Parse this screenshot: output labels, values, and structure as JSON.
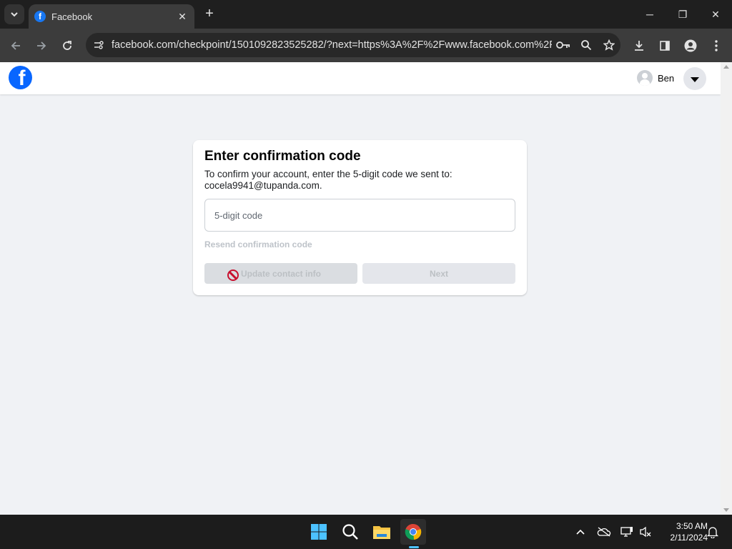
{
  "browser": {
    "tab_title": "Facebook",
    "tab_close": "✕",
    "new_tab": "+",
    "url": "facebook.com/checkpoint/1501092823525282/?next=https%3A%2F%2Fwww.facebook.com%2F...",
    "window_controls": {
      "minimize": "─",
      "restore": "❐",
      "close": "✕"
    }
  },
  "header": {
    "logo_letter": "f",
    "user_name": "Ben"
  },
  "card": {
    "title": "Enter confirmation code",
    "instructions": "To confirm your account, enter the 5-digit code we sent to: cocela9941@tupanda.com.",
    "code_placeholder": "5-digit code",
    "resend_label": "Resend confirmation code",
    "update_button": "Update contact info",
    "next_button": "Next"
  },
  "taskbar": {
    "time": "3:50 AM",
    "date": "2/11/2024"
  },
  "colors": {
    "brand": "#0866ff",
    "page_bg": "#f0f2f5"
  }
}
